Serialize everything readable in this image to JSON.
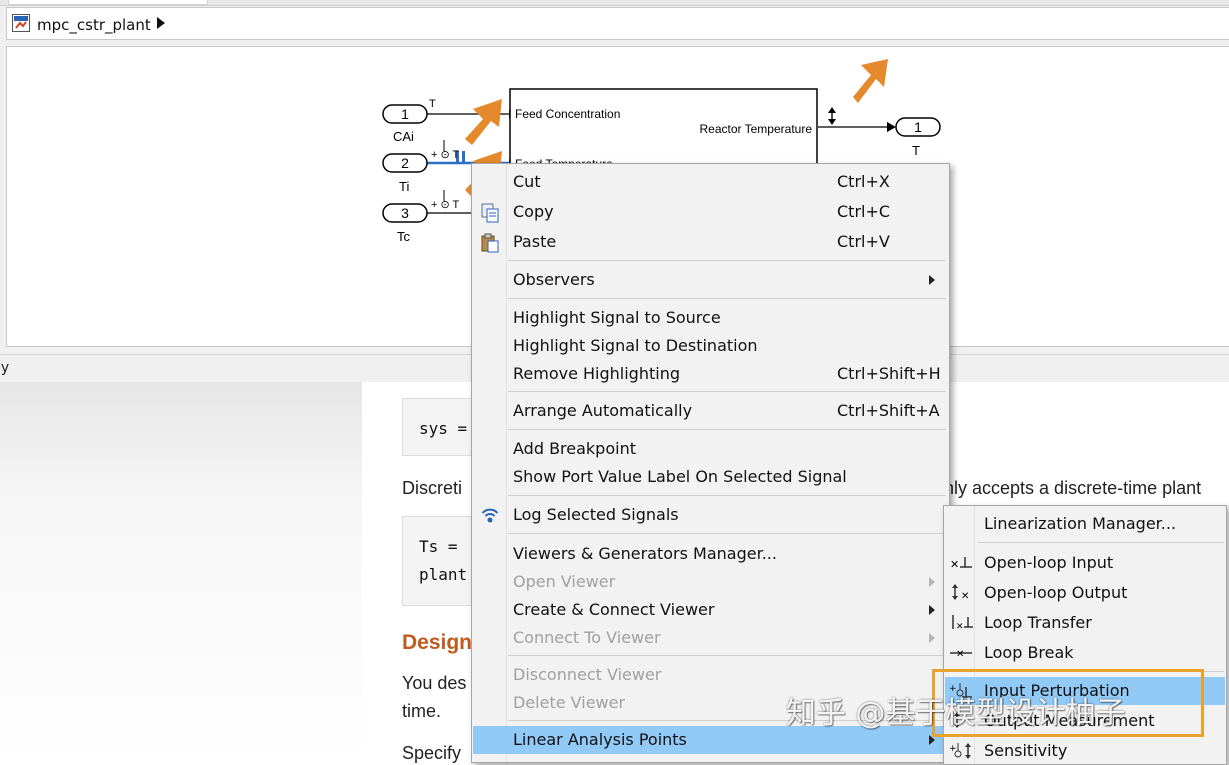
{
  "window": {
    "model_name": "mpc_cstr_plant",
    "status_text": "dy"
  },
  "diagram": {
    "inports": [
      {
        "number": "1",
        "name": "CAi",
        "signal_label": "T"
      },
      {
        "number": "2",
        "name": "Ti",
        "signal_label": "+ ⊙ T"
      },
      {
        "number": "3",
        "name": "Tc",
        "signal_label": "+ ⊙ T"
      }
    ],
    "subsystem": {
      "input_port_1": "Feed Concentration",
      "input_port_2": "Feed Temperature",
      "output_port_1": "Reactor Temperature"
    },
    "outport": {
      "number": "1",
      "name": "T"
    },
    "annotation_color": "#e48a2c"
  },
  "doc": {
    "code1": "sys =",
    "discretize_prefix": "Discreti",
    "discretize_suffix": "nly accepts a discrete-time plant",
    "code2_line1": "Ts =",
    "code2_line2": "plant",
    "heading": "Design",
    "para_line1": "You des",
    "para_line2": "time.",
    "specify": "Specify"
  },
  "context_menu": {
    "items": [
      {
        "label": "Cut",
        "shortcut": "Ctrl+X"
      },
      {
        "label": "Copy",
        "shortcut": "Ctrl+C",
        "icon": "copy-icon"
      },
      {
        "label": "Paste",
        "shortcut": "Ctrl+V",
        "icon": "paste-icon"
      },
      {
        "label": "Observers"
      },
      {
        "label": "Highlight Signal to Source"
      },
      {
        "label": "Highlight Signal to Destination"
      },
      {
        "label": "Remove Highlighting",
        "shortcut": "Ctrl+Shift+H"
      },
      {
        "label": "Arrange Automatically",
        "shortcut": "Ctrl+Shift+A"
      },
      {
        "label": "Add Breakpoint"
      },
      {
        "label": "Show Port Value Label On Selected Signal"
      },
      {
        "label": "Log Selected Signals",
        "icon": "log-signal-icon"
      },
      {
        "label": "Viewers & Generators Manager..."
      },
      {
        "label": "Open Viewer"
      },
      {
        "label": "Create & Connect Viewer"
      },
      {
        "label": "Connect To Viewer"
      },
      {
        "label": "Disconnect Viewer"
      },
      {
        "label": "Delete Viewer"
      },
      {
        "label": "Linear Analysis Points"
      }
    ]
  },
  "submenu": {
    "items": [
      {
        "label": "Linearization Manager..."
      },
      {
        "label": "Open-loop Input"
      },
      {
        "label": "Open-loop Output"
      },
      {
        "label": "Loop Transfer"
      },
      {
        "label": "Loop Break"
      },
      {
        "label": "Input Perturbation"
      },
      {
        "label": "Output Measurement"
      },
      {
        "label": "Sensitivity"
      }
    ]
  },
  "highlight_color": "#91c9f7",
  "callout_box_color": "#e8a32c",
  "watermark": "知乎 @基于模型设计柚子"
}
